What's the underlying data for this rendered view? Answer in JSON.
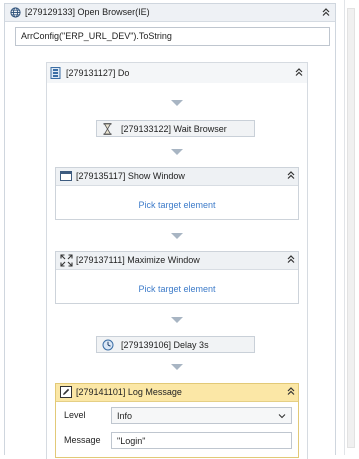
{
  "open_browser": {
    "title": "[279129133] Open Browser(IE)",
    "url_expression": "ArrConfig(\"ERP_URL_DEV\").ToString"
  },
  "do_sequence": {
    "title": "[279131127] Do"
  },
  "wait_browser": {
    "title": "[279133122] Wait Browser"
  },
  "show_window": {
    "title": "[279135117] Show Window",
    "pick_label": "Pick target element"
  },
  "maximize_window": {
    "title": "[279137111] Maximize Window",
    "pick_label": "Pick target element"
  },
  "delay": {
    "title": "[279139106] Delay 3s"
  },
  "log_message": {
    "title": "[279141101] Log Message",
    "level_label": "Level",
    "level_value": "Info",
    "message_label": "Message",
    "message_value": "\"Login\""
  },
  "icons": {
    "collapse": "double-chevron-up-icon",
    "globe": "globe-icon",
    "sequence": "sequence-icon",
    "hourglass": "hourglass-icon",
    "window": "window-icon",
    "maximize": "maximize-icon",
    "clock": "clock-icon",
    "log": "pencil-icon"
  },
  "colors": {
    "link": "#3d7bc9",
    "log_header": "#fbe7a6",
    "arrow": "#a8b5c3"
  }
}
